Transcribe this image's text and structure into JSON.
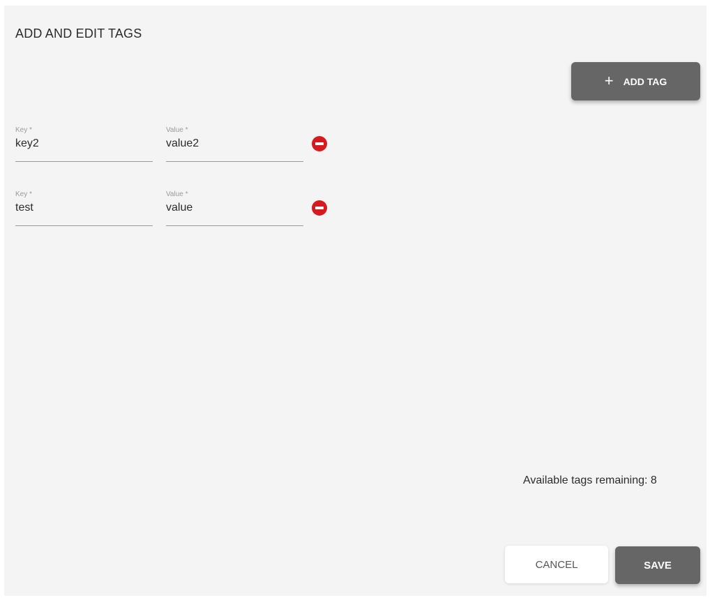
{
  "dialog": {
    "title": "ADD AND EDIT TAGS",
    "add_tag_label": "ADD TAG",
    "add_tag_icon": "plus-icon",
    "tags": [
      {
        "key_label": "Key *",
        "key_value": "key2",
        "value_label": "Value *",
        "value_value": "value2"
      },
      {
        "key_label": "Key *",
        "key_value": "test",
        "value_label": "Value *",
        "value_value": "value"
      }
    ],
    "remove_icon": "minus-circle-icon",
    "remaining_text": "Available tags remaining: 8",
    "cancel_label": "CANCEL",
    "save_label": "SAVE"
  },
  "colors": {
    "background": "#f4f4f4",
    "primary_button": "#666666",
    "remove_icon": "#d71920",
    "text": "#2b2b2b"
  }
}
